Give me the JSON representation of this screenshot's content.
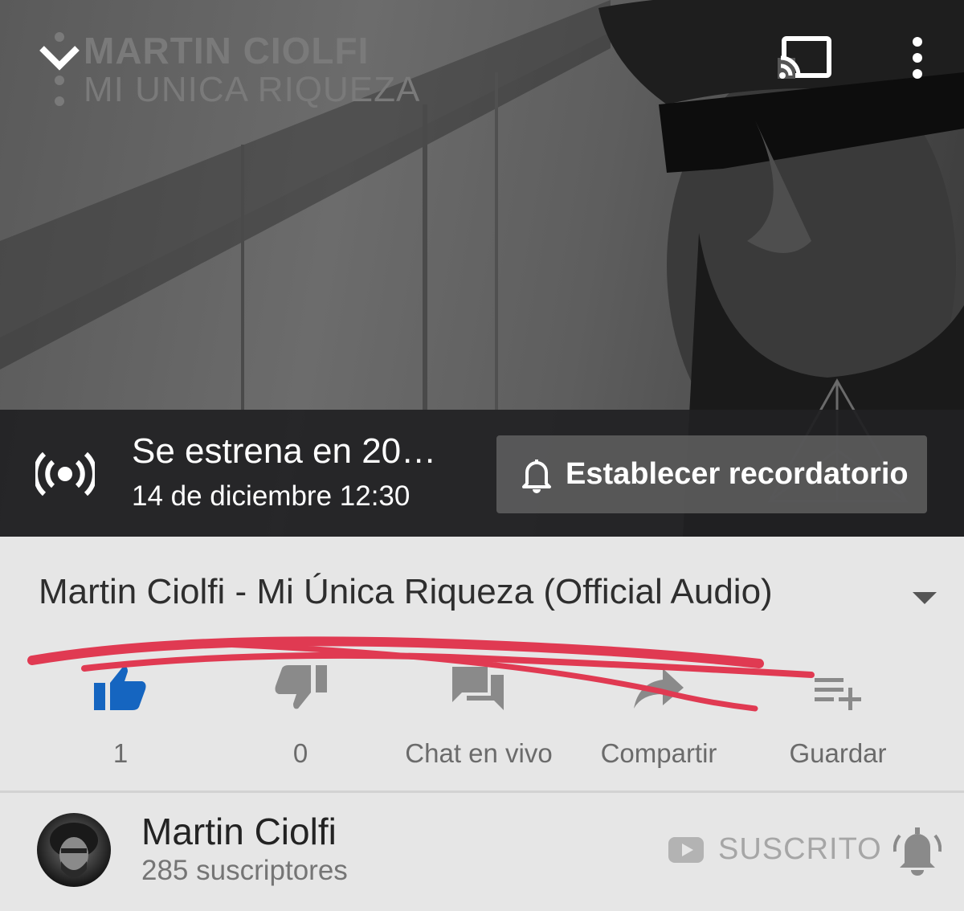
{
  "player": {
    "overlay_artist": "MARTIN CIOLFI",
    "overlay_song": "MI UNICA RIQUEZA",
    "icons": {
      "minimize": "chevron-down-icon",
      "cast": "cast-icon",
      "menu": "more-vert-icon"
    },
    "premiere": {
      "status": "Se estrena en 20…",
      "datetime": "14 de diciembre 12:30",
      "icon": "live-broadcast-icon",
      "reminder_label": "Establecer recordatorio",
      "reminder_icon": "bell-outline-icon"
    }
  },
  "video": {
    "title": "Martin Ciolfi - Mi Única Riqueza (Official Audio)",
    "expand_icon": "caret-down-icon"
  },
  "actions": [
    {
      "label": "1",
      "icon": "thumb-up-icon",
      "color": "#1565c0"
    },
    {
      "label": "0",
      "icon": "thumb-down-icon",
      "color": "#8a8a8a"
    },
    {
      "label": "Chat en vivo",
      "icon": "chat-icon",
      "color": "#8a8a8a"
    },
    {
      "label": "Compartir",
      "icon": "share-icon",
      "color": "#8a8a8a"
    },
    {
      "label": "Guardar",
      "icon": "playlist-add-icon",
      "color": "#8a8a8a"
    }
  ],
  "channel": {
    "name": "Martin Ciolfi",
    "subscribers": "285 suscriptores",
    "subscribe_label": "SUSCRITO",
    "notification_icon": "bell-icon"
  },
  "annotation_color": "#e03a52"
}
